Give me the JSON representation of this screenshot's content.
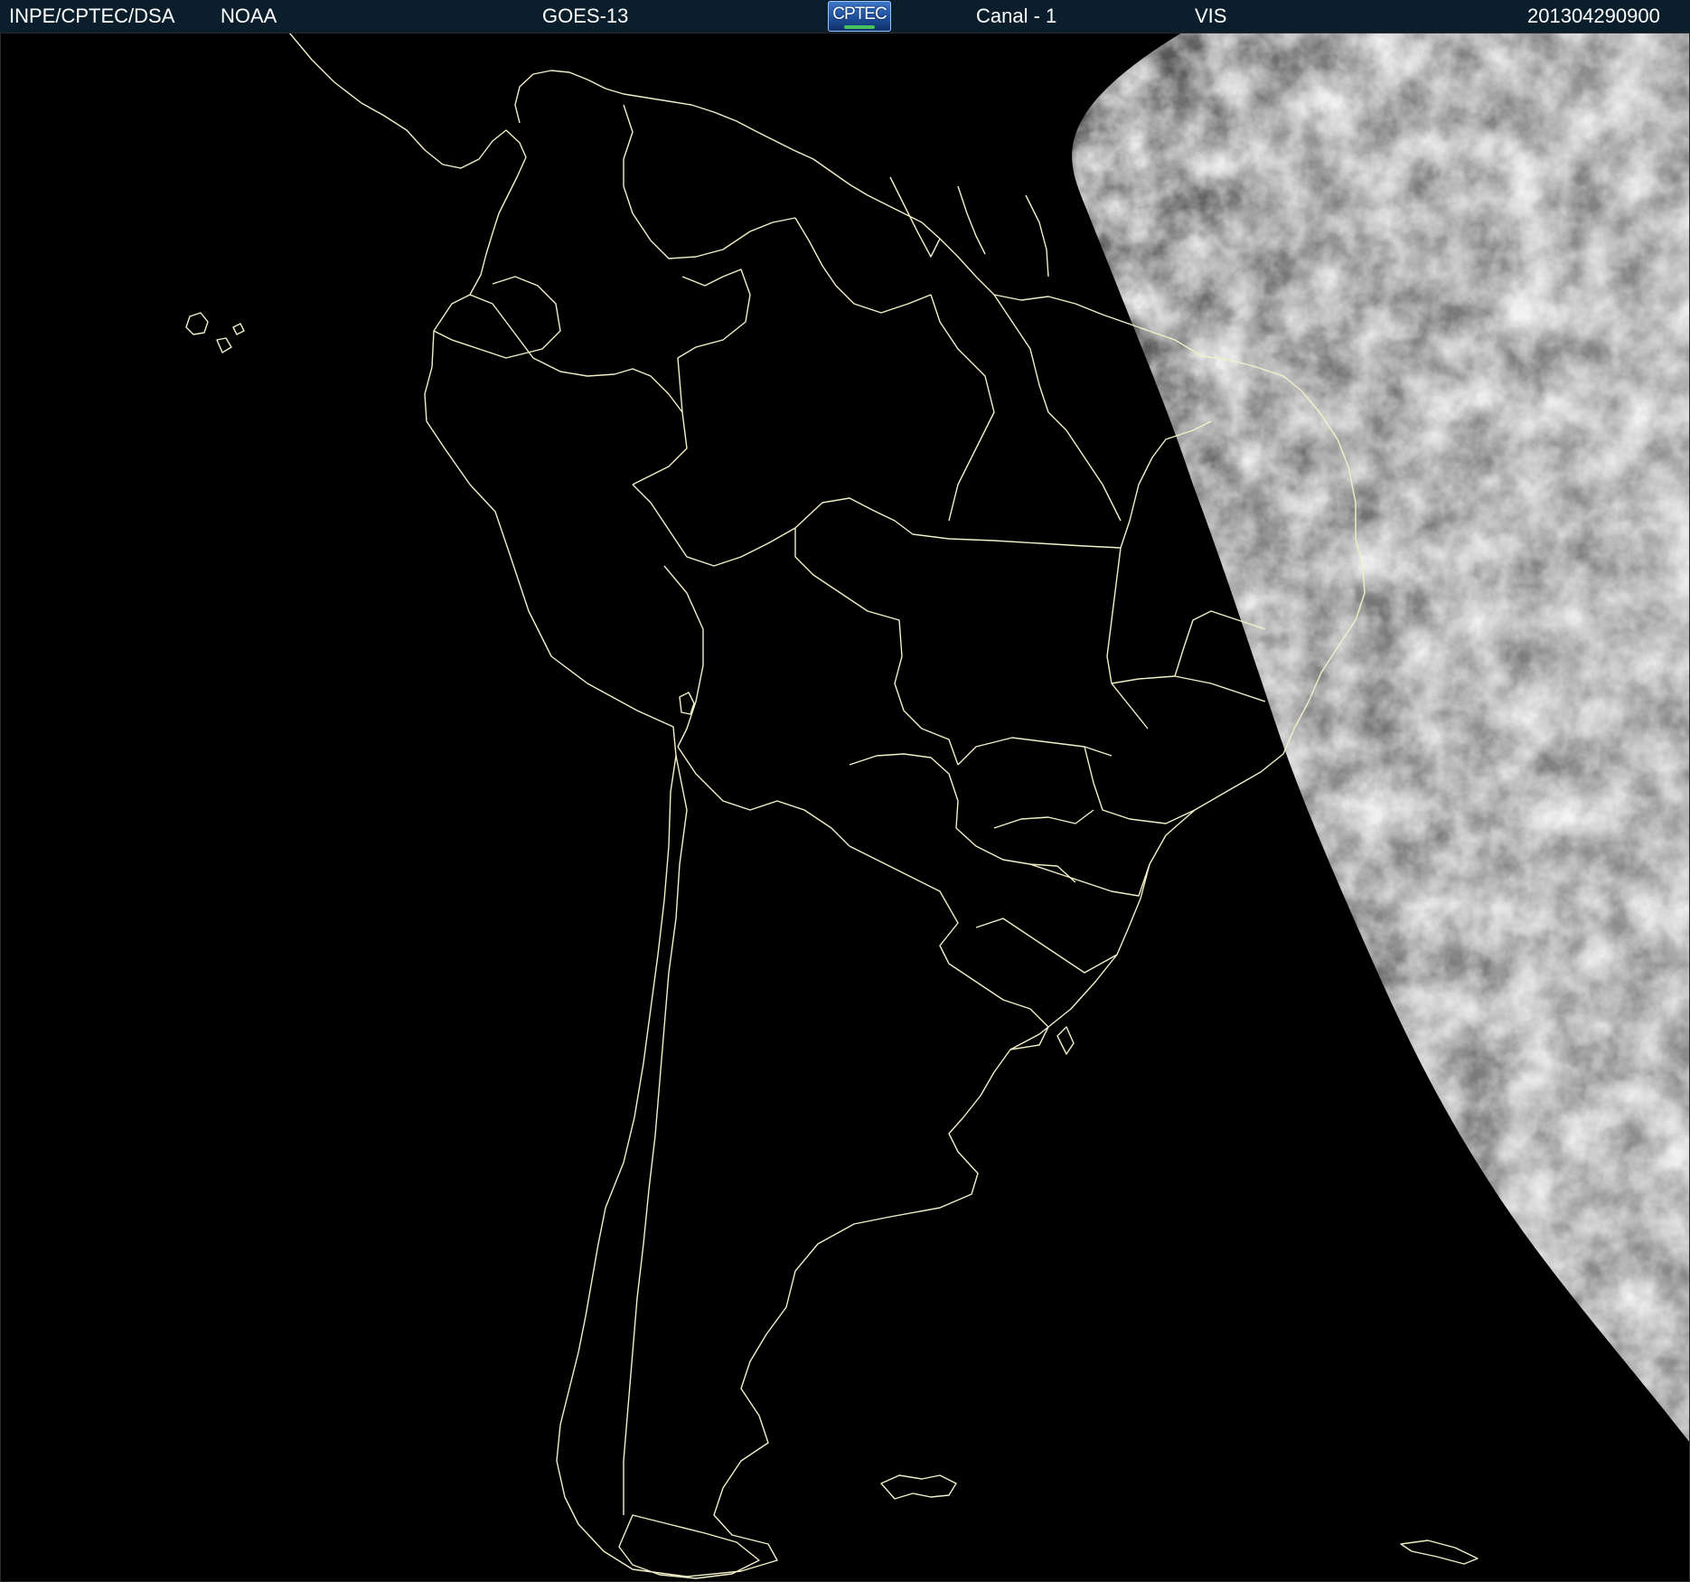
{
  "header": {
    "agency": "INPE/CPTEC/DSA",
    "source": "NOAA",
    "satellite": "GOES-13",
    "logo_text": "CPTEC",
    "channel": "Canal - 1",
    "band": "VIS",
    "timestamp": "201304290900"
  },
  "colors": {
    "header_bg": "#0a1e2c",
    "header_text": "#ffffff",
    "space": "#000000",
    "boundary_lines": "#f2f0c8",
    "clouds": "#d8d8d8"
  },
  "icons": {
    "logo": "cptec-logo"
  }
}
